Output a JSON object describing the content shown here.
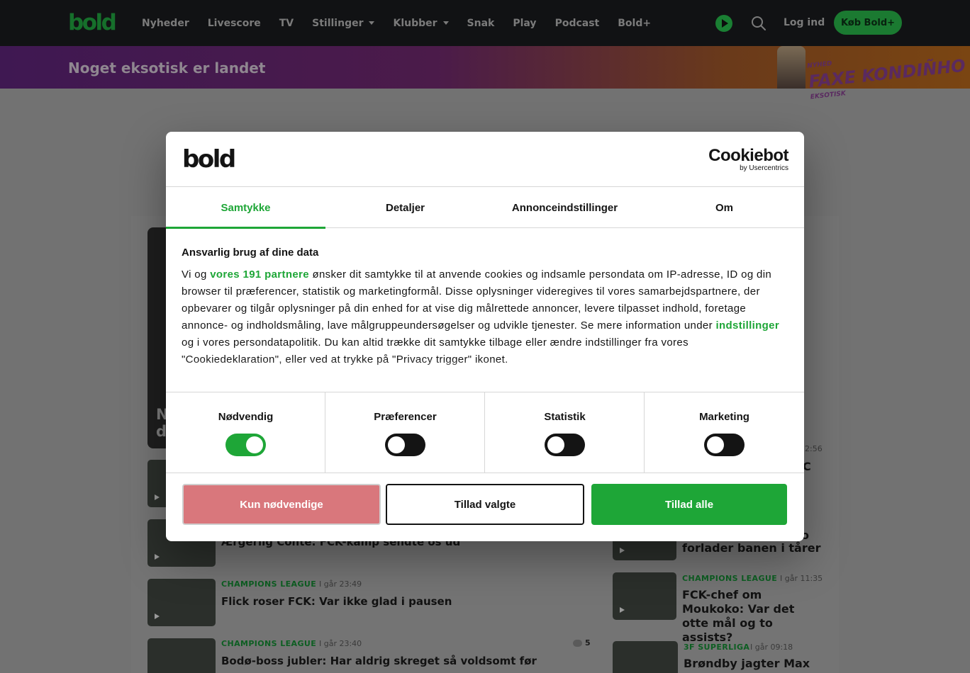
{
  "colors": {
    "brand_green": "#1ea637",
    "nav_background": "#111214",
    "reject_button": "#d9777c"
  },
  "header": {
    "logo": "bold",
    "nav": [
      {
        "label": "Nyheder",
        "has_dropdown": false
      },
      {
        "label": "Livescore",
        "has_dropdown": false
      },
      {
        "label": "TV",
        "has_dropdown": false
      },
      {
        "label": "Stillinger",
        "has_dropdown": true
      },
      {
        "label": "Klubber",
        "has_dropdown": true
      },
      {
        "label": "Snak",
        "has_dropdown": false
      },
      {
        "label": "Play",
        "has_dropdown": false
      },
      {
        "label": "Podcast",
        "has_dropdown": false
      },
      {
        "label": "Bold+",
        "has_dropdown": false
      }
    ],
    "login_label": "Log ind",
    "buy_label": "Køb Bold+",
    "icons": [
      "play-icon",
      "search-icon"
    ]
  },
  "promo": {
    "text": "Noget eksotisk er landet",
    "product_line1": "FAXE KONDIÑHO",
    "product_line2": "EKSOTISK",
    "product_tag": "NYHED"
  },
  "background_articles": {
    "hero_fragment_line1": "N",
    "hero_fragment_line2": "d",
    "left": [
      {
        "category": "",
        "time": "",
        "headline": "Ærgerlig Conte: FCK-kamp sendte os ud",
        "comments": ""
      },
      {
        "category": "CHAMPIONS LEAGUE",
        "time": "I går 23:49",
        "headline": "Flick roser FCK: Var ikke glad i pausen",
        "comments": ""
      },
      {
        "category": "CHAMPIONS LEAGUE",
        "time": "I går 23:40",
        "headline": "Bodø-boss jubler: Har aldrig skreget så voldsomt før",
        "comments": "5"
      }
    ],
    "right": [
      {
        "category": "",
        "time": "2:56",
        "headline": "C"
      },
      {
        "category": "",
        "time": "",
        "headline": "forlader banen i tårer",
        "headline_fragment": "o"
      },
      {
        "category": "CHAMPIONS LEAGUE",
        "time": "I går 11:35",
        "headline": "FCK-chef om Moukoko: Var det otte mål og to assists?"
      },
      {
        "category": "3F SUPERLIGA",
        "time": "I går 09:18",
        "headline": "Brøndby jagter Max"
      }
    ]
  },
  "consent": {
    "logo": "bold",
    "provider_name": "Cookiebot",
    "provider_sub": "by Usercentrics",
    "tabs": [
      "Samtykke",
      "Detaljer",
      "Annonceindstillinger",
      "Om"
    ],
    "active_tab": "Samtykke",
    "title": "Ansvarlig brug af dine data",
    "body_1": "Vi og",
    "partners_link": "vores 191 partnere",
    "body_2": "ønsker dit samtykke til at anvende cookies og indsamle persondata om IP-adresse, ID og din browser til præferencer, statistik og marketingformål. Disse oplysninger videregives til vores samarbejdspartnere, der opbevarer og tilgår oplysninger på din enhed for at vise dig målrettede annoncer, levere tilpasset indhold, foretage annonce- og indholdsmåling, lave målgruppeundersøgelser og udvikle tjenester. Se mere information under",
    "settings_link": "indstillinger",
    "body_3": "og i vores persondatapolitik. Du kan altid trække dit samtykke tilbage eller ændre indstillinger fra vores \"Cookiedeklaration\", eller ved at trykke på \"Privacy trigger\" ikonet.",
    "toggles": [
      {
        "label": "Nødvendig",
        "on": true
      },
      {
        "label": "Præferencer",
        "on": false
      },
      {
        "label": "Statistik",
        "on": false
      },
      {
        "label": "Marketing",
        "on": false
      }
    ],
    "buttons": {
      "necessary": "Kun nødvendige",
      "selected": "Tillad valgte",
      "all": "Tillad alle"
    }
  }
}
